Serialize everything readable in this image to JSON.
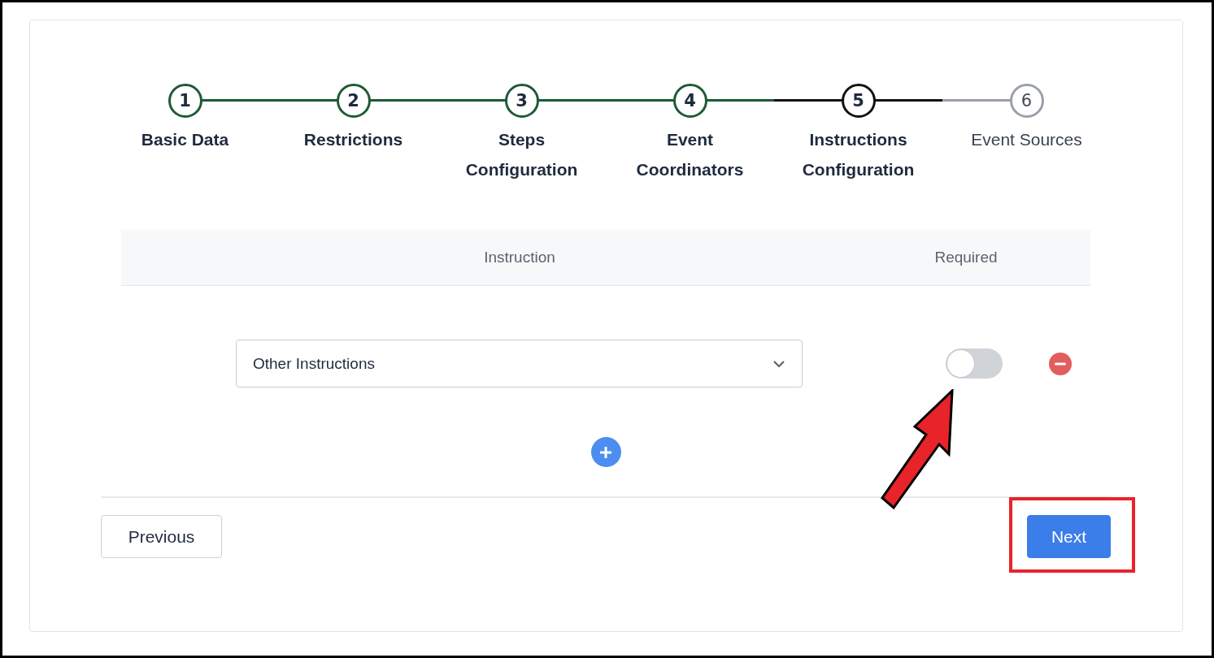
{
  "steps": [
    {
      "number": "1",
      "label": "Basic Data",
      "kind": "done"
    },
    {
      "number": "2",
      "label": "Restrictions",
      "kind": "done"
    },
    {
      "number": "3",
      "label": "Steps Configuration",
      "kind": "done"
    },
    {
      "number": "4",
      "label": "Event Coordinators",
      "kind": "done"
    },
    {
      "number": "5",
      "label": "Instructions Configuration",
      "kind": "current"
    },
    {
      "number": "6",
      "label": "Event Sources",
      "kind": "pending"
    }
  ],
  "table": {
    "columns": [
      "Instruction",
      "Required"
    ],
    "rows": [
      {
        "instruction": "Other Instructions",
        "required": false
      }
    ]
  },
  "buttons": {
    "previous": "Previous",
    "next": "Next"
  }
}
